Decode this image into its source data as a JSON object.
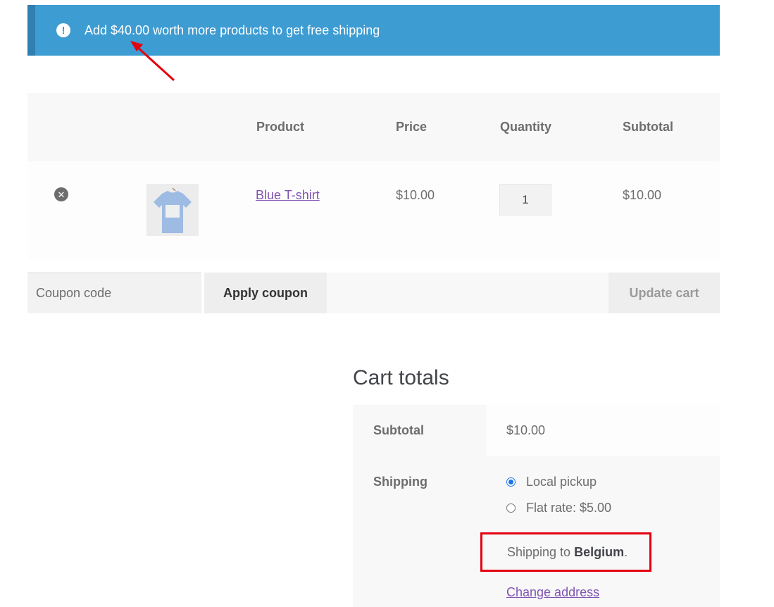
{
  "notice": {
    "icon": "exclamation-circle-icon",
    "message": "Add $40.00 worth more products to get free shipping"
  },
  "cart": {
    "columns": {
      "product": "Product",
      "price": "Price",
      "quantity": "Quantity",
      "subtotal": "Subtotal"
    },
    "items": [
      {
        "name": "Blue T-shirt",
        "price": "$10.00",
        "quantity": "1",
        "subtotal": "$10.00"
      }
    ]
  },
  "coupon": {
    "placeholder": "Coupon code",
    "apply_label": "Apply coupon",
    "update_label": "Update cart"
  },
  "totals": {
    "title": "Cart totals",
    "subtotal_label": "Subtotal",
    "subtotal_value": "$10.00",
    "shipping_label": "Shipping",
    "shipping_options": [
      {
        "label": "Local pickup",
        "selected": true
      },
      {
        "label": "Flat rate: $5.00",
        "selected": false
      }
    ],
    "shipping_to_prefix": "Shipping to ",
    "shipping_country": "Belgium",
    "shipping_to_suffix": ".",
    "change_address": "Change address"
  },
  "colors": {
    "notice_bg": "#3d9cd2",
    "link": "#7f54b3",
    "annotation": "#e4000f"
  }
}
